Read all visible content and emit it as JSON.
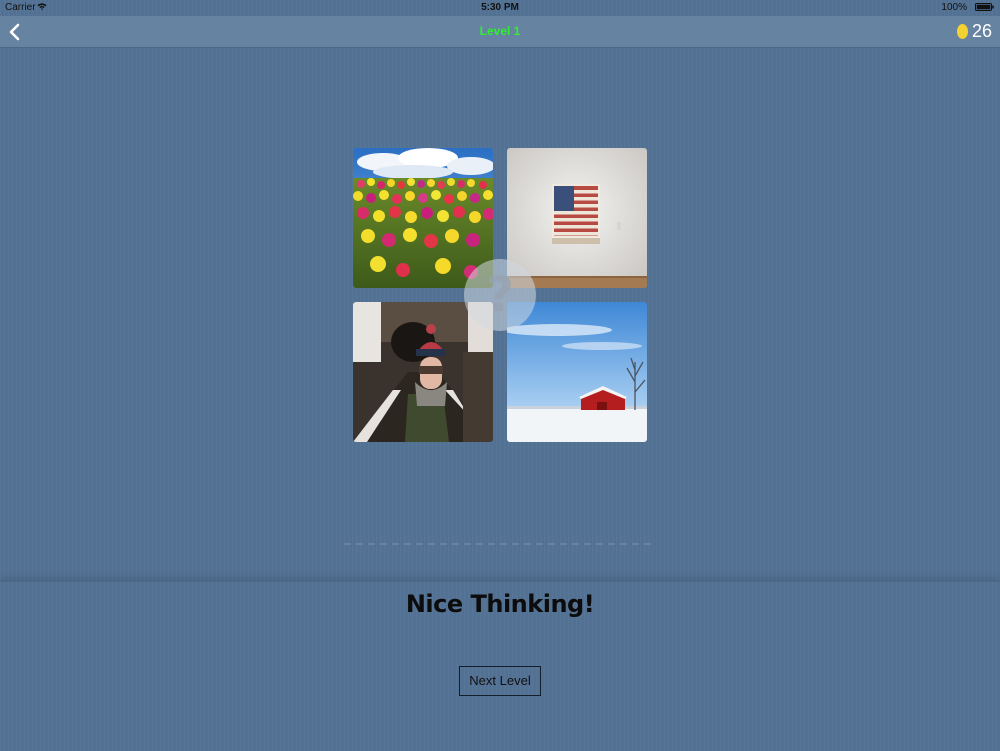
{
  "status_bar": {
    "carrier": "Carrier",
    "time": "5:30 PM",
    "battery": "100%"
  },
  "nav": {
    "title": "Level 1",
    "title_color": "#2ef02e",
    "coins": "26",
    "coin_color": "#f2d233",
    "back_icon": "chevron-left-icon"
  },
  "puzzle": {
    "images": [
      "tulip-field",
      "american-flag-painting",
      "woman-in-winter-hat",
      "red-barn-in-snow"
    ],
    "hint_symbol": "?"
  },
  "answer": {
    "slot_count": 20
  },
  "result": {
    "message": "Nice Thinking!",
    "next_button": "Next Level"
  },
  "colors": {
    "background": "#537294",
    "nav_background": "#6683a1"
  }
}
